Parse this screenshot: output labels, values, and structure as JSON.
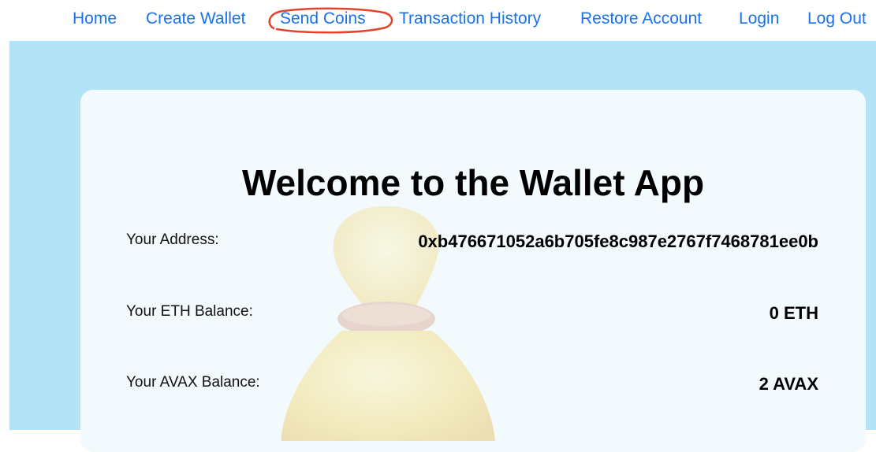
{
  "nav": {
    "home": "Home",
    "create_wallet": "Create Wallet",
    "send_coins": "Send Coins",
    "transaction_history": "Transaction History",
    "restore_account": "Restore Account",
    "login": "Login",
    "log_out": "Log Out"
  },
  "annotation": {
    "highlighted_item": "Send Coins",
    "color": "#e0442a"
  },
  "card": {
    "title": "Welcome to the Wallet App",
    "rows": [
      {
        "label": "Your Address:",
        "value": "0xb476671052a6b705fe8c987e2767f7468781ee0b"
      },
      {
        "label": "Your ETH Balance:",
        "value": "0 ETH"
      },
      {
        "label": "Your AVAX Balance:",
        "value": "2 AVAX"
      }
    ],
    "background_image": "money-bag-icon"
  },
  "colors": {
    "link": "#1a73e8",
    "backdrop": "#b3e3f7",
    "card": "#f2fafd"
  }
}
